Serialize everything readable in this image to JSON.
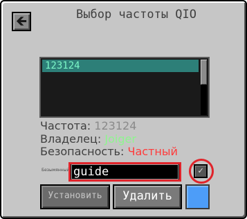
{
  "header": {
    "title": "Выбор частоты QIO",
    "back_icon": "arrow-left-icon",
    "back_symbol": "🡸"
  },
  "frequency_list": {
    "items": [
      {
        "label": "123124",
        "selected": true
      }
    ]
  },
  "details": {
    "frequency_label": "Частота:",
    "frequency_value": "123124",
    "owner_label": "Владелец:",
    "owner_value": "Joiger",
    "security_label": "Безопасность:",
    "security_value": "Частный"
  },
  "name_field": {
    "label": "Безымянный",
    "value": "guide"
  },
  "checkbox": {
    "icon": "checkmark-icon",
    "symbol": "✓",
    "checked": true
  },
  "buttons": {
    "set_label": "Установить",
    "delete_label": "Удалить"
  },
  "colors": {
    "list_selected_bg": "#2d7f78",
    "list_selected_text": "#7cf7c8",
    "owner_green": "#8ef58e",
    "security_red": "#ff3b3b",
    "annotation_red": "#e0242b",
    "color_swatch": "#4d9df8"
  }
}
